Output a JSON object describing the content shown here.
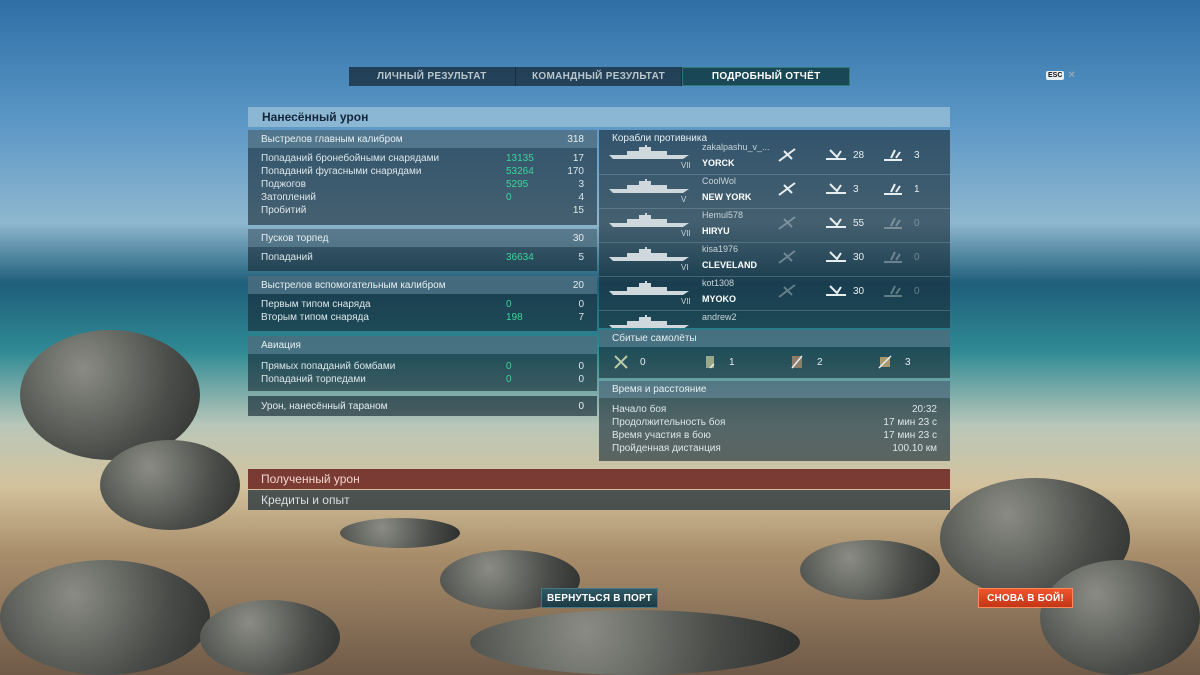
{
  "tabs": [
    {
      "label": "ЛИЧНЫЙ РЕЗУЛЬТАТ"
    },
    {
      "label": "КОМАНДНЫЙ РЕЗУЛЬТАТ"
    },
    {
      "label": "ПОДРОБНЫЙ ОТЧЁТ"
    }
  ],
  "esc": {
    "key": "ESC",
    "close": "✕"
  },
  "damage": {
    "title": "Нанесённый урон",
    "main_battery": {
      "label": "Выстрелов главным калибром",
      "value": "318",
      "rows": [
        {
          "label": "Попаданий бронебойными снарядами",
          "dmg": "13135",
          "count": "17"
        },
        {
          "label": "Попаданий фугасными снарядами",
          "dmg": "53264",
          "count": "170"
        },
        {
          "label": "Поджогов",
          "dmg": "5295",
          "count": "3"
        },
        {
          "label": "Затоплений",
          "dmg": "0",
          "count": "4"
        },
        {
          "label": "Пробитий",
          "dmg": "",
          "count": "15"
        }
      ]
    },
    "torpedoes": {
      "label": "Пусков торпед",
      "value": "30",
      "rows": [
        {
          "label": "Попаданий",
          "dmg": "36634",
          "count": "5"
        }
      ]
    },
    "secondary": {
      "label": "Выстрелов вспомогательным калибром",
      "value": "20",
      "rows": [
        {
          "label": "Первым типом снаряда",
          "dmg": "0",
          "count": "0"
        },
        {
          "label": "Вторым типом снаряда",
          "dmg": "198",
          "count": "7"
        }
      ]
    },
    "aviation": {
      "label": "Авиация",
      "rows": [
        {
          "label": "Прямых попаданий бомбами",
          "dmg": "0",
          "count": "0"
        },
        {
          "label": "Попаданий торпедами",
          "dmg": "0",
          "count": "0"
        }
      ]
    },
    "ram": {
      "label": "Урон, нанесённый тараном",
      "value": "0"
    }
  },
  "enemies": {
    "title": "Корабли противника",
    "ships": [
      {
        "player": "zakalpashu_v_...",
        "name": "YORCK",
        "tier": "VII",
        "a": "28",
        "b": "3"
      },
      {
        "player": "CoolWol",
        "name": "NEW YORK",
        "tier": "V",
        "a": "3",
        "b": "1"
      },
      {
        "player": "Hemul578",
        "name": "HIRYU",
        "tier": "VII",
        "a": "55",
        "b": "0"
      },
      {
        "player": "kisa1976",
        "name": "CLEVELAND",
        "tier": "VI",
        "a": "30",
        "b": "0"
      },
      {
        "player": "kot1308",
        "name": "MYOKO",
        "tier": "VII",
        "a": "30",
        "b": "0"
      },
      {
        "player": "andrew2",
        "name": "",
        "tier": "",
        "a": "",
        "b": ""
      }
    ]
  },
  "planes": {
    "title": "Сбитые самолёты",
    "items": [
      {
        "icon": "fighter-icon",
        "value": "0"
      },
      {
        "icon": "bomber-icon",
        "value": "1"
      },
      {
        "icon": "torpedo-bomber-icon",
        "value": "2"
      },
      {
        "icon": "spotter-icon",
        "value": "3"
      }
    ]
  },
  "time": {
    "title": "Время и расстояние",
    "rows": [
      {
        "label": "Начало боя",
        "value": "20:32"
      },
      {
        "label": "Продолжительность боя",
        "value": "17 мин 23 с"
      },
      {
        "label": "Время участия в бою",
        "value": "17 мин 23 с"
      },
      {
        "label": "Пройденная дистанция",
        "value": "100.10 км"
      }
    ]
  },
  "received": {
    "label": "Полученный урон"
  },
  "credits": {
    "label": "Кредиты и опыт"
  },
  "buttons": {
    "port": "ВЕРНУТЬСЯ В ПОРТ",
    "fight": "СНОВА В БОЙ!"
  },
  "colors": {
    "accent_green": "#3fd39a",
    "fight_button": "#e24a22",
    "received_bar": "#6e2824"
  }
}
